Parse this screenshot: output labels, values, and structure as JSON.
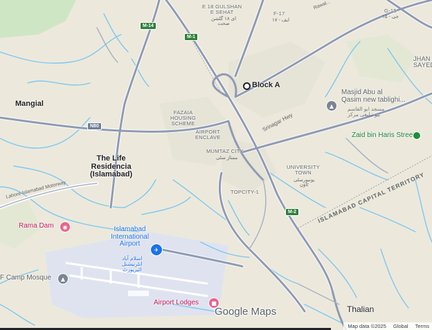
{
  "map": {
    "colors": {
      "land": "#ece9dc",
      "green": "#cfe6c5",
      "water": "#7cc8ee",
      "road": "#8f9bb3",
      "road_outline": "#ffffff",
      "airport": "#dfe3f0",
      "built": "#e3e1d6"
    },
    "labels": {
      "gulshan_e_sehat": "E 18 GULSHAN\nE SEHAT",
      "gulshan_e_sehat_urdu": "ای ۱۸ گلشن\nصحت",
      "f17": "F-17",
      "f17_urdu": "ایف - ۱۷",
      "g15": "G-15",
      "g15_urdu": "جی - ۱۵",
      "jhang_sayedan": "JHAN\nSAYED",
      "block_a": "Block A",
      "mangial": "Mangial",
      "fazaia": "FAZAIA\nHOUSING\nSCHEME",
      "airport_enclave": "AIRPORT\nENCLAVE",
      "mumtaz_city": "MUMTAZ CITY",
      "mumtaz_city_urdu": "ممتاز سٹی",
      "the_life": "The Life\nResidencia\n(Islamabad)",
      "university_town": "UNIVERSITY\nTOWN",
      "university_town_urdu": "یونیورسٹی\nٹاؤن",
      "topcity": "TOPCITY-1",
      "territory": "ISLAMABAD CAPITAL TERRITORY",
      "rama_dam": "Rama Dam",
      "masjid": "Masjid Abu al\nQasim new tablighi...",
      "masjid_urdu": "مسجد ابو القاسم\nنیو تبلیغی مرکز",
      "zaid": "Zaid bin Haris Street",
      "airport": "Islamabad\nInternational\nAirport",
      "airport_urdu": "اسلام آباد\nانٹرنیشنل\nائیرپورٹ",
      "camp_mosque": "F Camp Mosque",
      "airport_lodges": "Airport Lodges",
      "thalian": "Thalian",
      "srinagar_hwy": "Srinagar Hwy",
      "lahore_hwy": "Lahore-Islamabad Motorway",
      "ramzan_rd": "Rawal..."
    },
    "shields": {
      "m14": "M-14",
      "m1": "M-1",
      "n80": "N80",
      "m2": "M-2"
    },
    "icons": {
      "block_a": "circle-marker-icon",
      "rama_dam": "camera-icon",
      "masjid": "mosque-icon",
      "zaid": "pin-icon",
      "airport": "airplane-icon",
      "camp_mosque": "mosque-icon",
      "airport_lodges": "hotel-icon"
    },
    "logo": "Google Maps",
    "footer": {
      "map_data": "Map data ©2025",
      "global": "Global",
      "terms": "Terms"
    }
  }
}
